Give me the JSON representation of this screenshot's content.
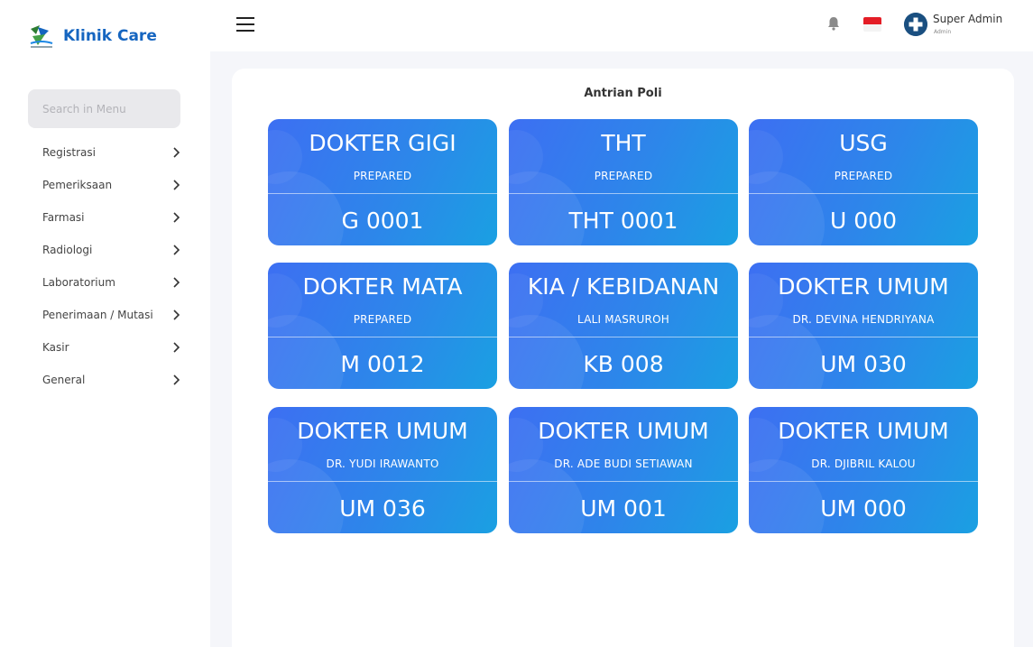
{
  "brand": {
    "name": "Klinik Care",
    "color": "#1565c0"
  },
  "search": {
    "placeholder": "Search in Menu"
  },
  "menu": [
    {
      "label": "Registrasi"
    },
    {
      "label": "Pemeriksaan"
    },
    {
      "label": "Farmasi"
    },
    {
      "label": "Radiologi"
    },
    {
      "label": "Laboratorium"
    },
    {
      "label": "Penerimaan / Mutasi"
    },
    {
      "label": "Kasir"
    },
    {
      "label": "General"
    }
  ],
  "topbar": {
    "menu_icon": "hamburger-icon",
    "notification_icon": "bell-icon",
    "language_icon": "flag-indonesia-icon",
    "user": {
      "name": "Super Admin",
      "role": "Admin",
      "avatar_icon": "plus-circle-icon"
    }
  },
  "content": {
    "title": "Antrian Poli",
    "cards": [
      {
        "title": "DOKTER GIGI",
        "subtitle": "PREPARED",
        "number": "G 0001"
      },
      {
        "title": "THT",
        "subtitle": "PREPARED",
        "number": "THT 0001"
      },
      {
        "title": "USG",
        "subtitle": "PREPARED",
        "number": "U 000"
      },
      {
        "title": "DOKTER MATA",
        "subtitle": "PREPARED",
        "number": "M 0012"
      },
      {
        "title": "KIA / KEBIDANAN",
        "subtitle": "LALI MASRUROH",
        "number": "KB 008"
      },
      {
        "title": "DOKTER UMUM",
        "subtitle": "DR. DEVINA HENDRIYANA",
        "number": "UM 030"
      },
      {
        "title": "DOKTER UMUM",
        "subtitle": "DR. YUDI IRAWANTO",
        "number": "UM 036"
      },
      {
        "title": "DOKTER UMUM",
        "subtitle": "DR. ADE BUDI SETIAWAN",
        "number": "UM 001"
      },
      {
        "title": "DOKTER UMUM",
        "subtitle": "DR. DJIBRIL KALOU",
        "number": "UM 000"
      }
    ]
  },
  "colors": {
    "card_gradient_start": "#3d6ff2",
    "card_gradient_end": "#1aa0e2",
    "page_background": "#f5f6fa"
  }
}
